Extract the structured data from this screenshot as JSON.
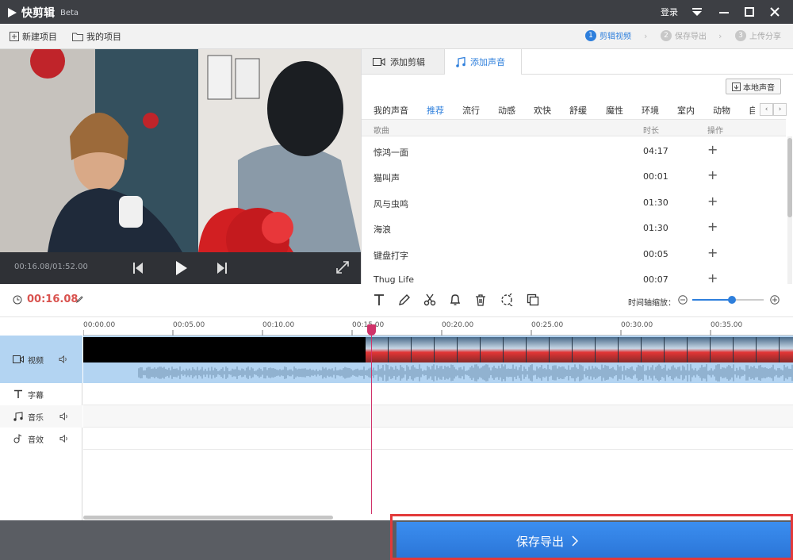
{
  "titlebar": {
    "app_name": "快剪辑",
    "beta": "Beta",
    "login": "登录"
  },
  "toolbar": {
    "new_project": "新建项目",
    "my_projects": "我的项目",
    "steps": [
      {
        "num": "1",
        "label": "剪辑视频"
      },
      {
        "num": "2",
        "label": "保存导出"
      },
      {
        "num": "3",
        "label": "上传分享"
      }
    ]
  },
  "player": {
    "time": "00:16.08/01:52.00"
  },
  "panel": {
    "tab_edit": "添加剪辑",
    "tab_audio": "添加声音",
    "local_sound": "本地声音",
    "categories": [
      "我的声音",
      "推荐",
      "流行",
      "动感",
      "欢快",
      "舒缓",
      "魔性",
      "环境",
      "室内",
      "动物",
      "自"
    ],
    "list_headers": {
      "name": "歌曲",
      "duration": "时长",
      "action": "操作"
    },
    "songs": [
      {
        "name": "惊鸿一面",
        "duration": "04:17"
      },
      {
        "name": "猫叫声",
        "duration": "00:01"
      },
      {
        "name": "风与虫鸣",
        "duration": "01:30"
      },
      {
        "name": "海浪",
        "duration": "01:30"
      },
      {
        "name": "键盘打字",
        "duration": "00:05"
      },
      {
        "name": "Thug Life",
        "duration": "00:07"
      }
    ]
  },
  "editbar": {
    "current_time": "00:16.08",
    "zoom_label": "时间轴缩放："
  },
  "ruler": {
    "ticks": [
      "00:00.00",
      "00:05.00",
      "00:10.00",
      "00:15.00",
      "00:20.00",
      "00:25.00",
      "00:30.00",
      "00:35.00"
    ]
  },
  "tracks": {
    "video": "视频",
    "subtitle": "字幕",
    "music": "音乐",
    "sfx": "音效"
  },
  "export": {
    "label": "保存导出"
  },
  "colors": {
    "accent": "#2e7fdc",
    "playhead": "#d0336a",
    "highlight": "#e23a3a"
  }
}
